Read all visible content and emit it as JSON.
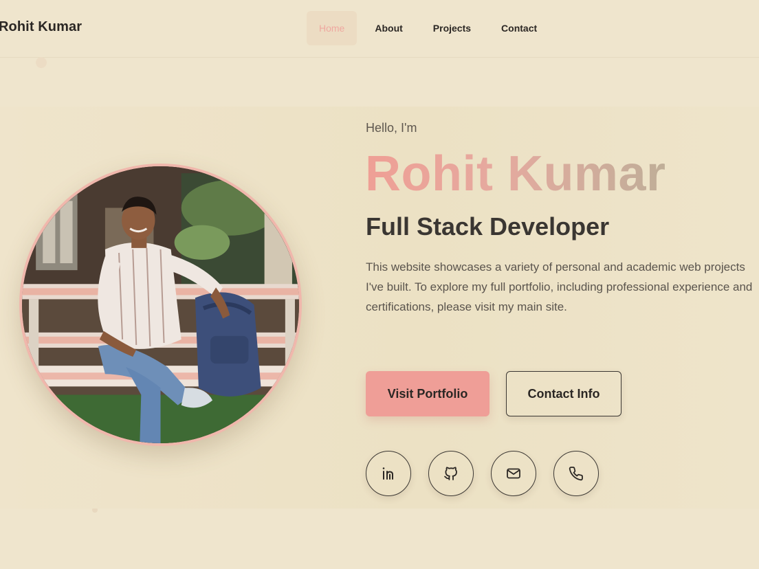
{
  "nav": {
    "brand": "Rohit Kumar",
    "links": [
      {
        "label": "Home",
        "active": true
      },
      {
        "label": "About",
        "active": false
      },
      {
        "label": "Projects",
        "active": false
      },
      {
        "label": "Contact",
        "active": false
      }
    ]
  },
  "hero": {
    "greeting": "Hello, I'm",
    "name": "Rohit Kumar",
    "role": "Full Stack Developer",
    "bio": "This website showcases a variety of personal and academic web projects I've built. To explore my full portfolio, including professional experience and certifications, please visit my main site.",
    "primary_button": "Visit Portfolio",
    "secondary_button": "Contact Info",
    "socials": [
      {
        "icon": "linkedin-icon"
      },
      {
        "icon": "github-icon"
      },
      {
        "icon": "mail-icon"
      },
      {
        "icon": "phone-icon"
      }
    ]
  },
  "colors": {
    "background": "#efe5cd",
    "accent": "#ef9e97",
    "active_nav_bg": "#ecdcc3",
    "text": "#2b2724"
  }
}
